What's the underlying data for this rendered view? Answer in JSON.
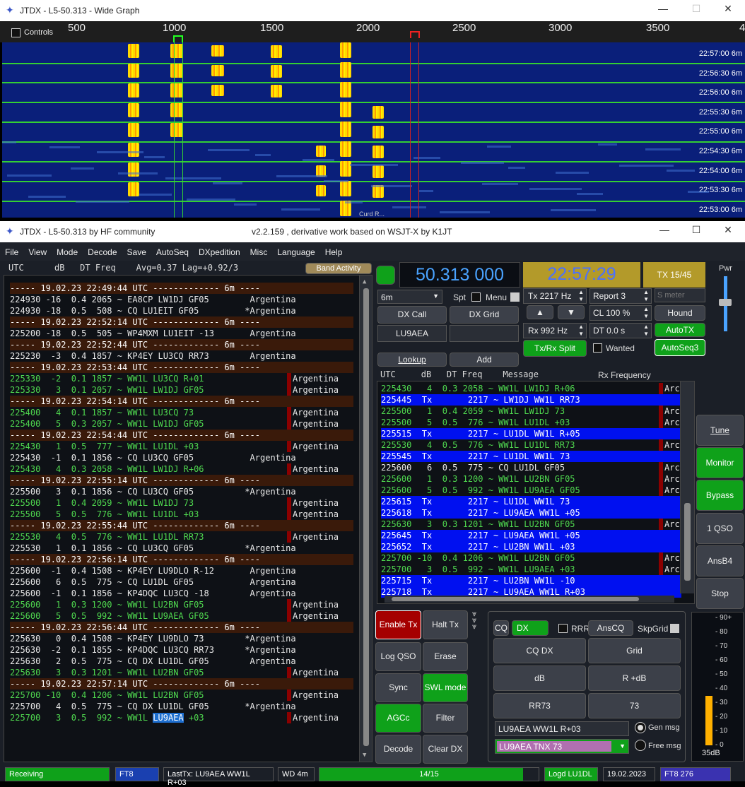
{
  "wide_graph": {
    "title": "JTDX - L5-50.313 - Wide Graph",
    "controls_label": "Controls",
    "ticks": [
      "500",
      "1000",
      "1500",
      "2000",
      "2500",
      "3000",
      "3500",
      "4"
    ],
    "timestamps": [
      "22:57:00  6m",
      "22:56:30  6m",
      "22:56:00  6m",
      "22:55:30  6m",
      "22:55:00  6m",
      "22:54:30  6m",
      "22:54:00  6m",
      "22:53:30  6m",
      "22:53:00  6m"
    ],
    "bottom_label": "Curd R..."
  },
  "main_window": {
    "title_left": "JTDX - L5-50.313  by HF community",
    "title_center": "v2.2.159 , derivative work based on WSJT-X by K1JT"
  },
  "menu": [
    "File",
    "View",
    "Mode",
    "Decode",
    "Save",
    "AutoSeq",
    "DXpedition",
    "Misc",
    "Language",
    "Help"
  ],
  "band_activity": {
    "header": "UTC      dB   DT Freq    Avg=0.37 Lag=+0.92/3",
    "button": "Band Activity",
    "lines": [
      {
        "t": "----- 19.02.23 22:49:44 UTC ------------- 6m ----",
        "k": "sep"
      },
      {
        "t": "224930 -16  0.4 2065 ~ EA8CP LW1DJ GF05        Argentina",
        "k": "w"
      },
      {
        "t": "224930 -18  0.5  508 ~ CQ LU1EIT GF05         *Argentina",
        "k": "w"
      },
      {
        "t": "----- 19.02.23 22:52:14 UTC ------------- 6m ----",
        "k": "sep"
      },
      {
        "t": "225200 -18  0.5  505 ~ WP4MXM LU1EIT -13       Argentina",
        "k": "w"
      },
      {
        "t": "----- 19.02.23 22:52:44 UTC ------------- 6m ----",
        "k": "sep"
      },
      {
        "t": "225230  -3  0.4 1857 ~ KP4EY LU3CQ RR73        Argentina",
        "k": "w"
      },
      {
        "t": "----- 19.02.23 22:53:44 UTC ------------- 6m ----",
        "k": "sep"
      },
      {
        "t": "225330  -2  0.1 1857 ~ WW1L LU3CQ R+01        ",
        "c": "Argentina",
        "k": "g"
      },
      {
        "t": "225330   3  0.1 2057 ~ WW1L LW1DJ GF05        ",
        "c": "Argentina",
        "k": "g"
      },
      {
        "t": "----- 19.02.23 22:54:14 UTC ------------- 6m ----",
        "k": "sep"
      },
      {
        "t": "225400   4  0.1 1857 ~ WW1L LU3CQ 73          ",
        "c": "Argentina",
        "k": "g"
      },
      {
        "t": "225400   5  0.3 2057 ~ WW1L LW1DJ GF05        ",
        "c": "Argentina",
        "k": "g"
      },
      {
        "t": "----- 19.02.23 22:54:44 UTC ------------- 6m ----",
        "k": "sep"
      },
      {
        "t": "225430   1  0.5  777 ~ WW1L LU1DL +03         ",
        "c": "Argentina",
        "k": "g"
      },
      {
        "t": "225430  -1  0.1 1856 ~ CQ LU3CQ GF05           Argentina",
        "k": "w"
      },
      {
        "t": "225430   4  0.3 2058 ~ WW1L LW1DJ R+06        ",
        "c": "Argentina",
        "k": "g"
      },
      {
        "t": "----- 19.02.23 22:55:14 UTC ------------- 6m ----",
        "k": "sep"
      },
      {
        "t": "225500   3  0.1 1856 ~ CQ LU3CQ GF05          *Argentina",
        "k": "w"
      },
      {
        "t": "225500   1  0.4 2059 ~ WW1L LW1DJ 73          ",
        "c": "Argentina",
        "k": "g"
      },
      {
        "t": "225500   5  0.5  776 ~ WW1L LU1DL +03         ",
        "c": "Argentina",
        "k": "g"
      },
      {
        "t": "----- 19.02.23 22:55:44 UTC ------------- 6m ----",
        "k": "sep"
      },
      {
        "t": "225530   4  0.5  776 ~ WW1L LU1DL RR73        ",
        "c": "Argentina",
        "k": "g"
      },
      {
        "t": "225530   1  0.1 1856 ~ CQ LU3CQ GF05          *Argentina",
        "k": "w"
      },
      {
        "t": "----- 19.02.23 22:56:14 UTC ------------- 6m ----",
        "k": "sep"
      },
      {
        "t": "225600  -1  0.4 1508 ~ KP4EY LU9DLO R-12       Argentina",
        "k": "w"
      },
      {
        "t": "225600   6  0.5  775 ~ CQ LU1DL GF05           Argentina",
        "k": "w"
      },
      {
        "t": "225600  -1  0.1 1856 ~ KP4DQC LU3CQ -18        Argentina",
        "k": "w"
      },
      {
        "t": "225600   1  0.3 1200 ~ WW1L LU2BN GF05        ",
        "c": "Argentina",
        "k": "g"
      },
      {
        "t": "225600   5  0.5  992 ~ WW1L LU9AEA GF05       ",
        "c": "Argentina",
        "k": "g"
      },
      {
        "t": "----- 19.02.23 22:56:44 UTC ------------- 6m ----",
        "k": "sep"
      },
      {
        "t": "225630   0  0.4 1508 ~ KP4EY LU9DLO 73        *Argentina",
        "k": "w"
      },
      {
        "t": "225630  -2  0.1 1855 ~ KP4DQC LU3CQ RR73      *Argentina",
        "k": "w"
      },
      {
        "t": "225630   2  0.5  775 ~ CQ DX LU1DL GF05        Argentina",
        "k": "w"
      },
      {
        "t": "225630   3  0.3 1201 ~ WW1L LU2BN GF05        ",
        "c": "Argentina",
        "k": "g"
      },
      {
        "t": "----- 19.02.23 22:57:14 UTC ------------- 6m ----",
        "k": "sep"
      },
      {
        "t": "225700 -10  0.4 1206 ~ WW1L LU2BN GF05        ",
        "c": "Argentina",
        "k": "g"
      },
      {
        "t": "225700   4  0.5  775 ~ CQ DX LU1DL GF05       *Argentina",
        "k": "w"
      },
      {
        "t": "225700   3  0.5  992 ~ WW1L LU9AEA +03        ",
        "c": "Argentina",
        "k": "g",
        "hl": "LU9AEA"
      }
    ]
  },
  "controls": {
    "frequency": "50.313 000",
    "clock": "22:57:29",
    "tx_slot": "TX 15/45",
    "pwr_label": "Pwr",
    "band": "6m",
    "spt": "Spt",
    "menu_label": "Menu",
    "dx_call_btn": "DX Call",
    "dx_grid_btn": "DX Grid",
    "dx_call_value": "LU9AEA",
    "tx_freq": "Tx  2217 Hz",
    "rx_freq": "Rx  992 Hz",
    "report": "Report 3",
    "cl": "CL  100 %",
    "dt": "DT 0.0 s",
    "s_meter": "S meter",
    "hound": "Hound",
    "autotx": "AutoTX",
    "autoseq3": "AutoSeq3",
    "txrx_split": "Tx/Rx Split",
    "wanted": "Wanted",
    "lookup": "Lookup",
    "add": "Add",
    "up": "▲",
    "down": "▼"
  },
  "rx_frequency": {
    "header": "UTC     dB   DT Freq    Message",
    "header_right": "Rx Frequency",
    "lines": [
      {
        "t": "225430   4  0.3 2058 ~ WW1L LW1DJ R+06",
        "k": "g",
        "c": "Arc"
      },
      {
        "t": "225445  Tx       2217 ~ LW1DJ WW1L RR73",
        "k": "tx"
      },
      {
        "t": "225500   1  0.4 2059 ~ WW1L LW1DJ 73",
        "k": "g",
        "c": "Arc"
      },
      {
        "t": "225500   5  0.5  776 ~ WW1L LU1DL +03",
        "k": "g",
        "c": "Arc"
      },
      {
        "t": "225515  Tx       2217 ~ LU1DL WW1L R+05",
        "k": "tx"
      },
      {
        "t": "225530   4  0.5  776 ~ WW1L LU1DL RR73",
        "k": "g",
        "c": "Arc"
      },
      {
        "t": "225545  Tx       2217 ~ LU1DL WW1L 73",
        "k": "tx"
      },
      {
        "t": "225600   6  0.5  775 ~ CQ LU1DL GF05",
        "k": "w",
        "c": "Arc"
      },
      {
        "t": "225600   1  0.3 1200 ~ WW1L LU2BN GF05",
        "k": "g",
        "c": "Arc"
      },
      {
        "t": "225600   5  0.5  992 ~ WW1L LU9AEA GF05",
        "k": "g",
        "c": "Arc"
      },
      {
        "t": "225615  Tx       2217 ~ LU1DL WW1L 73",
        "k": "tx"
      },
      {
        "t": "225618  Tx       2217 ~ LU9AEA WW1L +05",
        "k": "tx"
      },
      {
        "t": "225630   3  0.3 1201 ~ WW1L LU2BN GF05",
        "k": "g",
        "c": "Arc"
      },
      {
        "t": "225645  Tx       2217 ~ LU9AEA WW1L +05",
        "k": "tx"
      },
      {
        "t": "225652  Tx       2217 ~ LU2BN WW1L +03",
        "k": "tx"
      },
      {
        "t": "225700 -10  0.4 1206 ~ WW1L LU2BN GF05",
        "k": "g",
        "c": "Arc"
      },
      {
        "t": "225700   3  0.5  992 ~ WW1L LU9AEA +03",
        "k": "g",
        "c": "Arc"
      },
      {
        "t": "225715  Tx       2217 ~ LU2BN WW1L -10",
        "k": "tx"
      },
      {
        "t": "225718  Tx       2217 ~ LU9AEA WW1L R+03",
        "k": "tx"
      }
    ]
  },
  "buttons": {
    "enable_tx": "Enable Tx",
    "halt_tx": "Halt Tx",
    "log_qso": "Log QSO",
    "erase": "Erase",
    "sync": "Sync",
    "swl_mode": "SWL mode",
    "agcc": "AGCc",
    "filter": "Filter",
    "decode": "Decode",
    "clear_dx": "Clear DX",
    "cq": "CQ",
    "dx": "DX",
    "rrr": "RRR",
    "anscq": "AnsCQ",
    "skpgrid": "SkpGrid",
    "cq_dx": "CQ DX",
    "grid": "Grid",
    "db": "dB",
    "r_db": "R +dB",
    "rr73": "RR73",
    "seventy_three": "73",
    "gen_msg_value": "LU9AEA WW1L R+03",
    "gen_msg": "Gen msg",
    "free_msg_value": "LU9AEA TNX 73",
    "free_msg": "Free msg",
    "tune": "Tune",
    "monitor": "Monitor",
    "bypass": "Bypass",
    "one_qso": "1 QSO",
    "ansb4": "AnsB4",
    "stop": "Stop"
  },
  "meter": {
    "ticks": [
      "90+",
      "80",
      "70",
      "60",
      "50",
      "40",
      "30",
      "20",
      "10",
      "0"
    ],
    "level": "35dB",
    "level_value": 35
  },
  "status": {
    "receiving": "Receiving",
    "mode": "FT8",
    "last_tx": "LastTx: LU9AEA WW1L R+03",
    "wd": "WD 4m",
    "progress": "14/15",
    "progress_value": 0.93,
    "logd": "Logd LU1DL",
    "date": "19.02.2023",
    "mode2": "FT8  276"
  },
  "colors": {
    "green": "#0fa11a",
    "tx_blue": "#0010f0",
    "separator": "#3a1a0a",
    "freq_blue": "#4aa3ff",
    "clock_bg": "#b39a2a"
  }
}
